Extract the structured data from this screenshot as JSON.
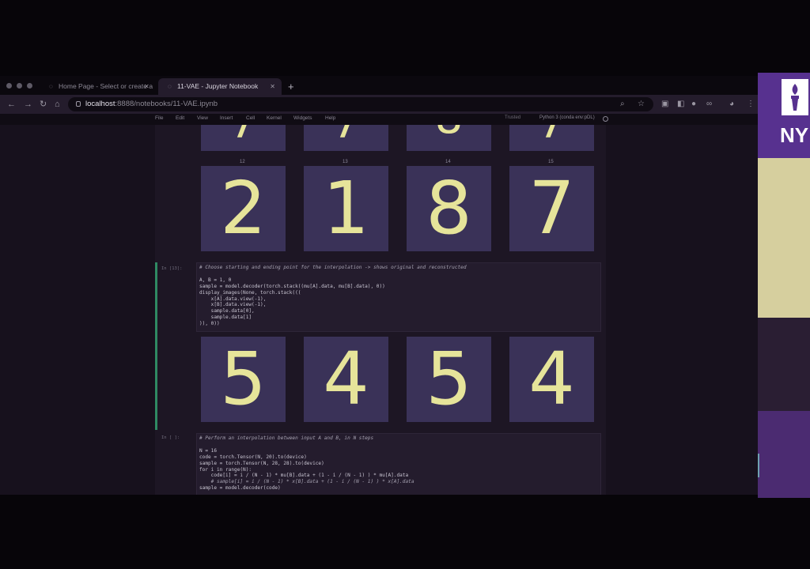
{
  "tabs": [
    {
      "label": "Home Page - Select or create a",
      "icon": "jupyter-icon",
      "active": false
    },
    {
      "label": "11-VAE - Jupyter Notebook",
      "icon": "jupyter-icon",
      "active": true
    }
  ],
  "address": {
    "host": "localhost",
    "path": ":8888/notebooks/11-VAE.ipynb"
  },
  "menu": [
    "File",
    "Edit",
    "View",
    "Insert",
    "Cell",
    "Kernel",
    "Widgets",
    "Help"
  ],
  "status": {
    "trusted": "Trusted",
    "kernel": "Python 3 (conda env:pDL)"
  },
  "grid1": {
    "indices": [
      "12",
      "13",
      "14",
      "15"
    ],
    "digits": [
      "2",
      "1",
      "8",
      "7"
    ]
  },
  "cell1": {
    "prompt": "In [13]:",
    "code": [
      "# Choose starting and ending point for the interpolation -> shows original and reconstructed",
      "",
      "A, B = 1, 0",
      "sample = model.decoder(torch.stack((mu[A].data, mu[B].data), 0))",
      "display_images(None, torch.stack(((",
      "    x[A].data.view(-1),",
      "    x[B].data.view(-1),",
      "    sample.data[0],",
      "    sample.data[1]",
      ")), 0))"
    ],
    "output_digits": [
      "5",
      "4",
      "5",
      "4"
    ]
  },
  "cell2": {
    "prompt": "In [ ]:",
    "code": [
      "# Perform an interpolation between input A and B, in N steps",
      "",
      "N = 16",
      "code = torch.Tensor(N, 20).to(device)",
      "sample = torch.Tensor(N, 28, 28).to(device)",
      "for i in range(N):",
      "    code[i] = i / (N - 1) * mu[B].data + (1 - i / (N - 1) ) * mu[A].data",
      "    # sample[i] = i / (N - 1) * x[B].data + (1 - i / (N - 1) ) * x[A].data",
      "sample = model.decoder(code)"
    ]
  },
  "side_panel": {
    "logo_text": "NY"
  },
  "colors": {
    "jupyter_selected": "#2f8a63",
    "digit_fg": "#e6e49a",
    "digit_bg": "#3a3258",
    "nyu_purple": "#57318f"
  }
}
